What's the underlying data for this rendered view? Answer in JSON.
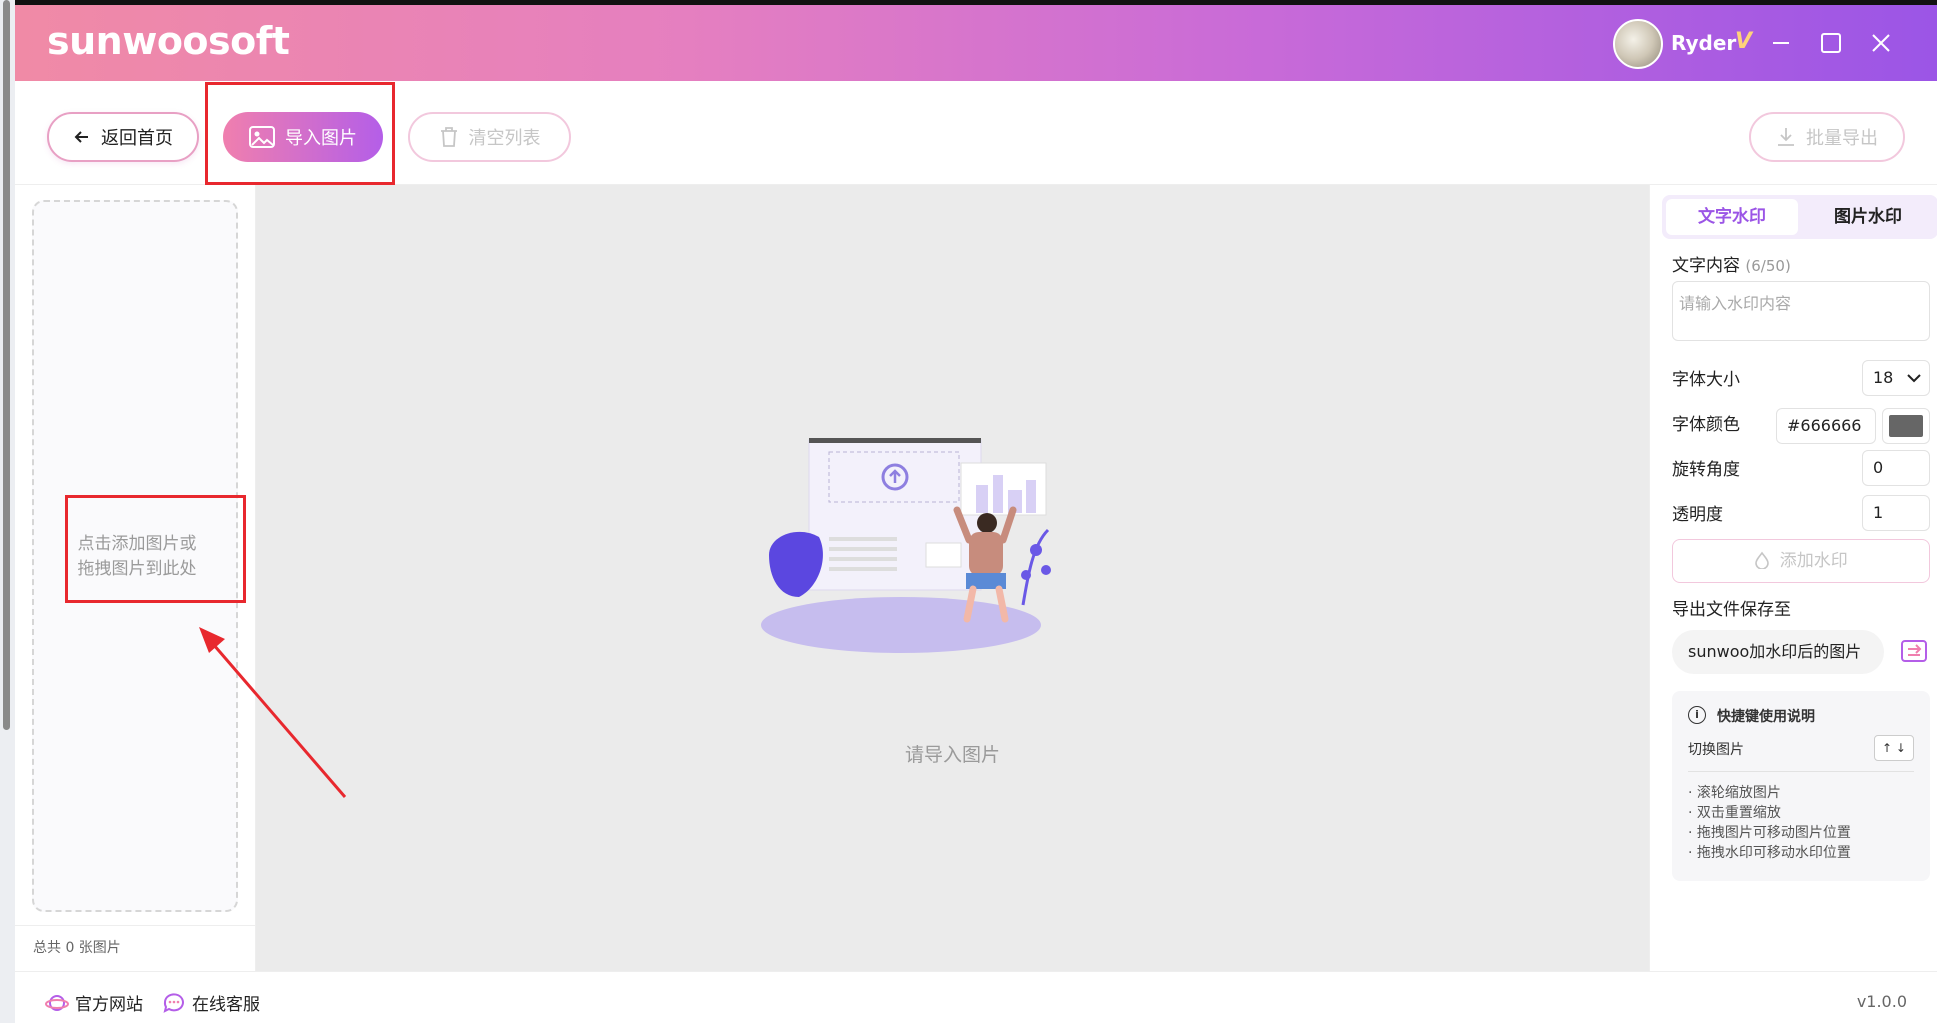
{
  "app": {
    "logo": "sunwoosoft",
    "user_name": "Ryder",
    "vip": "V"
  },
  "toolbar": {
    "home_label": "返回首页",
    "import_label": "导入图片",
    "clear_label": "清空列表",
    "export_label": "批量导出"
  },
  "left": {
    "drop_line1": "点击添加图片或",
    "drop_line2": "拖拽图片到此处",
    "total": "总共 0 张图片"
  },
  "center": {
    "empty_text": "请导入图片"
  },
  "right": {
    "tab_text": "文字水印",
    "tab_image": "图片水印",
    "content_label": "文字内容",
    "content_count": "(6/50)",
    "content_placeholder": "请输入水印内容",
    "font_size_label": "字体大小",
    "font_size_value": "18",
    "font_color_label": "字体颜色",
    "font_color_value": "#666666",
    "rotation_label": "旋转角度",
    "rotation_value": "0",
    "opacity_label": "透明度",
    "opacity_value": "1",
    "add_button": "添加水印",
    "export_label": "导出文件保存至",
    "export_path": "sunwoo加水印后的图片",
    "help_title": "快捷键使用说明",
    "switch_label": "切换图片",
    "switch_keys": "↑ ↓",
    "help_items": [
      "滚轮缩放图片",
      "双击重置缩放",
      "拖拽图片可移动图片位置",
      "拖拽水印可移动水印位置"
    ]
  },
  "footer": {
    "website": "官方网站",
    "support": "在线客服",
    "version": "v1.0.0"
  },
  "colors": {
    "accent": "#9b55e6",
    "brand_pink": "#f07fae",
    "highlight_red": "#e8282e",
    "font_color_swatch": "#666666"
  }
}
